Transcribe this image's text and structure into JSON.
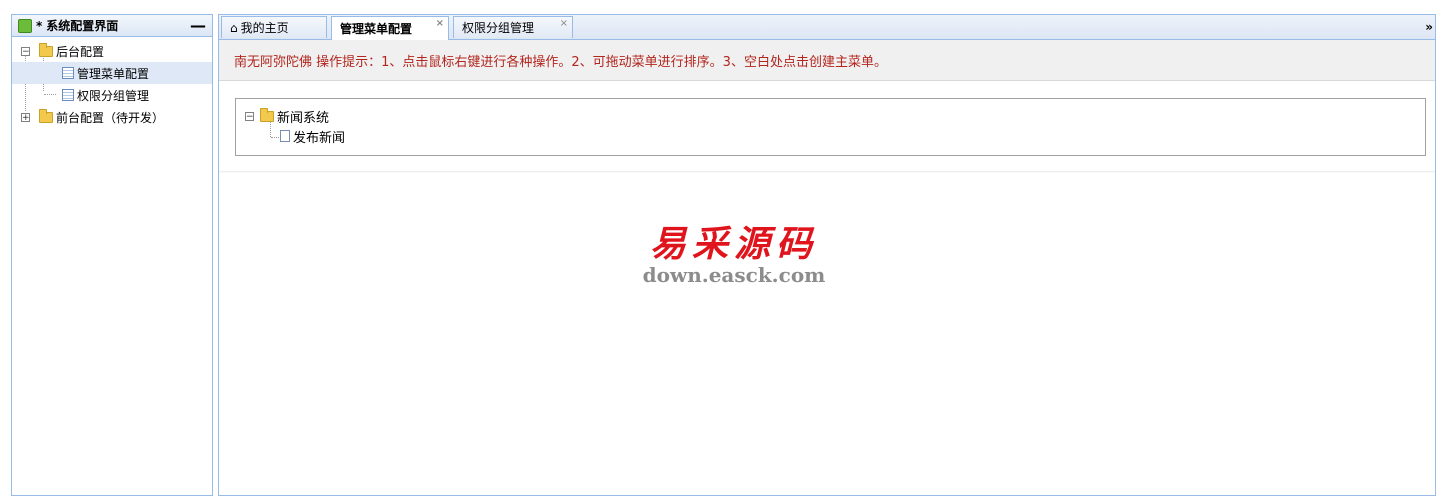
{
  "left_panel": {
    "title": "系统配置界面",
    "collapse_label": "—",
    "tree": [
      {
        "label": "后台配置",
        "toggle": "−"
      },
      {
        "label": "管理菜单配置"
      },
      {
        "label": "权限分组管理"
      },
      {
        "label": "前台配置（待开发）",
        "toggle": "+"
      }
    ]
  },
  "tabs": [
    {
      "label": "我的主页"
    },
    {
      "label": "管理菜单配置",
      "close": "×"
    },
    {
      "label": "权限分组管理",
      "close": "×"
    }
  ],
  "tab_scroll_label": "»",
  "hint": "南无阿弥陀佛 操作提示：1、点击鼠标右键进行各种操作。2、可拖动菜单进行排序。3、空白处点击创建主菜单。",
  "menu_tree": {
    "root": {
      "label": "新闻系统",
      "toggle": "−"
    },
    "child": {
      "label": "发布新闻"
    }
  },
  "watermark": {
    "title": "易采源码",
    "url": "down.easck.com"
  },
  "colors": {
    "hint_text": "#b3261e",
    "watermark_red": "#e0141c",
    "border_blue": "#99bbe8"
  }
}
